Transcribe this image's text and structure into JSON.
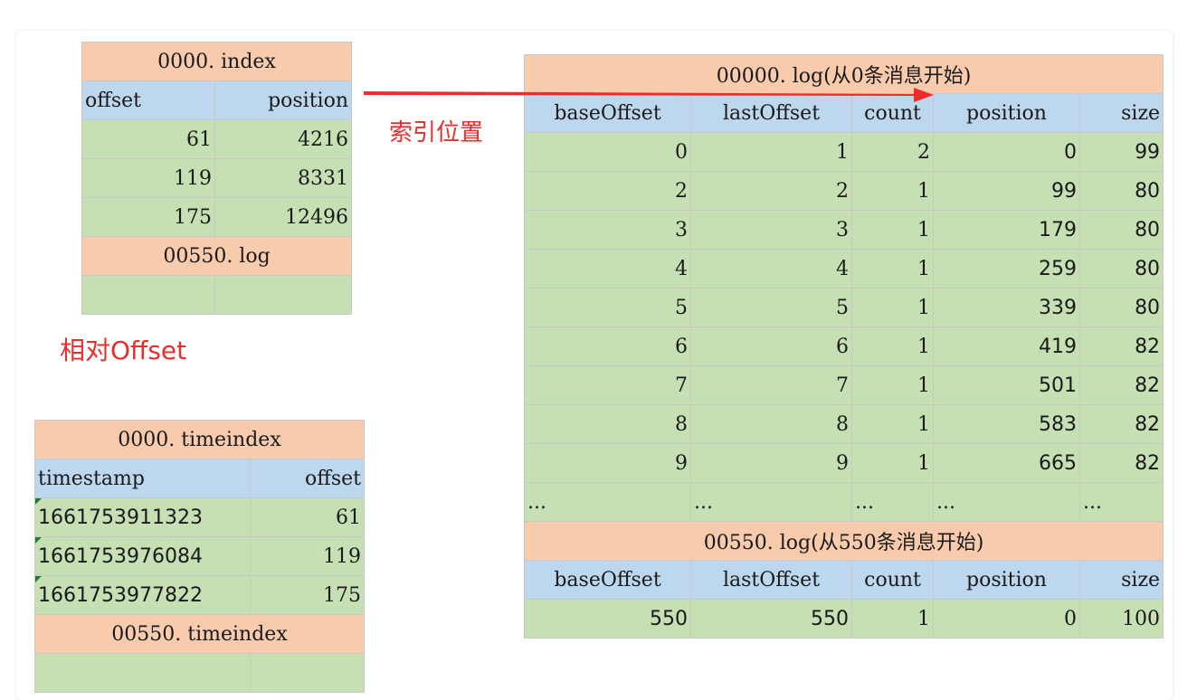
{
  "index_table": {
    "title": "0000. index",
    "headers": [
      "offset",
      "position"
    ],
    "rows": [
      [
        "61",
        "4216"
      ],
      [
        "119",
        "8331"
      ],
      [
        "175",
        "12496"
      ]
    ],
    "next_file": "00550. log"
  },
  "timeindex_table": {
    "title": "0000. timeindex",
    "headers": [
      "timestamp",
      "offset"
    ],
    "rows": [
      [
        "1661753911323",
        "61"
      ],
      [
        "1661753976084",
        "119"
      ],
      [
        "1661753977822",
        "175"
      ]
    ],
    "next_file": "00550. timeindex"
  },
  "log_table": {
    "title": "00000. log(从0条消息开始)",
    "headers": [
      "baseOffset",
      "lastOffset",
      "count",
      "position",
      "size"
    ],
    "rows": [
      [
        "0",
        "1",
        "2",
        "0",
        "99"
      ],
      [
        "2",
        "2",
        "1",
        "99",
        "80"
      ],
      [
        "3",
        "3",
        "1",
        "179",
        "80"
      ],
      [
        "4",
        "4",
        "1",
        "259",
        "80"
      ],
      [
        "5",
        "5",
        "1",
        "339",
        "80"
      ],
      [
        "6",
        "6",
        "1",
        "419",
        "82"
      ],
      [
        "7",
        "7",
        "1",
        "501",
        "82"
      ],
      [
        "8",
        "8",
        "1",
        "583",
        "82"
      ],
      [
        "9",
        "9",
        "1",
        "665",
        "82"
      ]
    ],
    "ellipsis": [
      "...",
      "...",
      "...",
      "...",
      "..."
    ],
    "second_title": "00550. log(从550条消息开始)",
    "second_headers": [
      "baseOffset",
      "lastOffset",
      "count",
      "position",
      "size"
    ],
    "second_row": [
      "550",
      "550",
      "1",
      "0",
      "100"
    ]
  },
  "annotations": {
    "index_position": "索引位置",
    "relative_offset": "相对Offset"
  },
  "colors": {
    "title_fill": "#f8cbad",
    "header_fill": "#bdd7ee",
    "data_fill": "#c6e0b4",
    "annotation_red": "#ee2c2c"
  }
}
